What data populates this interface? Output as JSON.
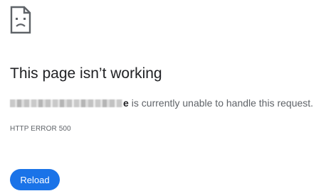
{
  "icon": "sad-page-icon",
  "title": "This page isn’t working",
  "message": {
    "host_tail": "e",
    "text": "is currently unable to handle this request."
  },
  "error_code": "HTTP ERROR 500",
  "reload_label": "Reload",
  "colors": {
    "accent": "#1a73e8",
    "title": "#202124",
    "secondary_text": "#5f6368"
  }
}
